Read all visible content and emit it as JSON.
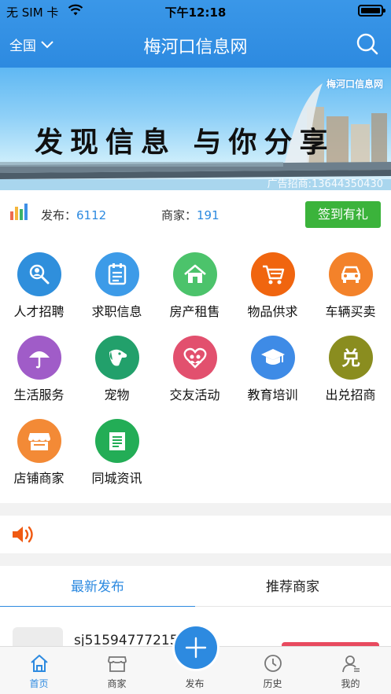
{
  "status_bar": {
    "carrier": "无 SIM 卡",
    "time": "下午12:18"
  },
  "nav": {
    "region": "全国",
    "title": "梅河口信息网"
  },
  "banner": {
    "slogan": "发现信息 与你分享",
    "brand": "梅河口信息网",
    "ad": "广告招商:13644350430"
  },
  "stats": {
    "publish_label": "发布：",
    "publish_value": "6112",
    "merchant_label": "商家：",
    "merchant_value": "191",
    "checkin_label": "签到有礼"
  },
  "categories": [
    {
      "label": "人才招聘",
      "icon": "search-person-icon",
      "color": "#2f8fdc"
    },
    {
      "label": "求职信息",
      "icon": "document-icon",
      "color": "#3d9be8"
    },
    {
      "label": "房产租售",
      "icon": "house-icon",
      "color": "#4cc36b"
    },
    {
      "label": "物品供求",
      "icon": "cart-icon",
      "color": "#f0650f"
    },
    {
      "label": "车辆买卖",
      "icon": "car-icon",
      "color": "#f3822a"
    },
    {
      "label": "生活服务",
      "icon": "umbrella-icon",
      "color": "#a05cc8"
    },
    {
      "label": "宠物",
      "icon": "dog-icon",
      "color": "#22a06b"
    },
    {
      "label": "交友活动",
      "icon": "heart-people-icon",
      "color": "#e2506e"
    },
    {
      "label": "教育培训",
      "icon": "graduation-cap-icon",
      "color": "#3e8be6"
    },
    {
      "label": "出兑招商",
      "icon": "dui-char-icon",
      "color": "#8a8d1f"
    },
    {
      "label": "店铺商家",
      "icon": "shop-icon",
      "color": "#f38a36"
    },
    {
      "label": "同城资讯",
      "icon": "news-icon",
      "color": "#23ad56"
    }
  ],
  "tabs": {
    "latest": "最新发布",
    "recommended": "推荐商家"
  },
  "listing": {
    "name": "sj51594777215"
  },
  "bottom_nav": {
    "home": "首页",
    "merchants": "商家",
    "publish": "发布",
    "history": "历史",
    "mine": "我的"
  },
  "colors": {
    "primary": "#2d8ae0",
    "checkin": "#3bb33b",
    "notice": "#f05a12"
  }
}
